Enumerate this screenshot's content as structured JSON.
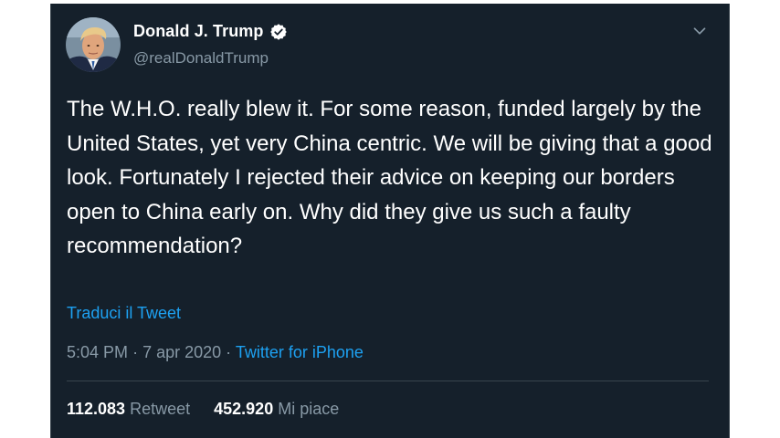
{
  "author": {
    "display_name": "Donald J. Trump",
    "handle": "@realDonaldTrump",
    "verified": true
  },
  "icons": {
    "avatar": "profile-photo",
    "verified": "verified-badge-icon",
    "more": "chevron-down-icon"
  },
  "tweet": {
    "text": "The W.H.O. really blew it. For some reason, funded largely by the United States, yet very China centric. We will be giving that a good look. Fortunately I rejected their advice on keeping our borders open to China early on. Why did they give us such a faulty recommendation?",
    "translate_label": "Traduci il Tweet",
    "time": "5:04 PM",
    "date": "7 apr 2020",
    "separator": "·",
    "source": "Twitter for iPhone"
  },
  "stats": {
    "retweets_count": "112.083",
    "retweets_label": "Retweet",
    "likes_count": "452.920",
    "likes_label": "Mi piace"
  },
  "colors": {
    "background": "#15202b",
    "accent": "#1da1f2",
    "secondary_text": "#8899a6",
    "divider": "#38444d"
  }
}
